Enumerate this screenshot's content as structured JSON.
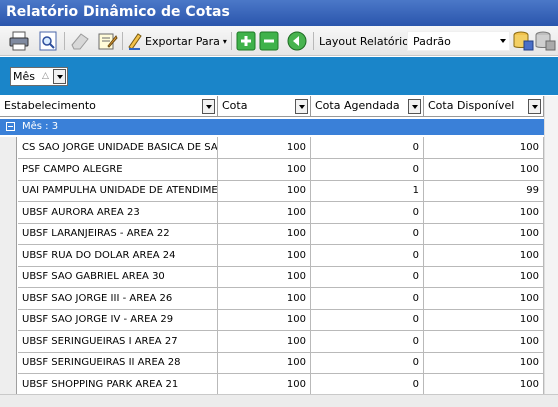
{
  "window": {
    "title": "Relatório Dinâmico de Cotas"
  },
  "toolbar": {
    "export_label": "Exportar Para",
    "layout_label": "Layout Relatório",
    "layout_value": "Padrão"
  },
  "group_panel": {
    "chip_label": "Mês"
  },
  "columns": [
    "Estabelecimento",
    "Cota",
    "Cota Agendada",
    "Cota Disponível"
  ],
  "group_row": {
    "label": "Mês : 3"
  },
  "rows": [
    {
      "estabelecimento": "CS SAO JORGE UNIDADE BASICA DE SAUD",
      "cota": "100",
      "agendada": "0",
      "disponivel": "100"
    },
    {
      "estabelecimento": "PSF CAMPO ALEGRE",
      "cota": "100",
      "agendada": "0",
      "disponivel": "100"
    },
    {
      "estabelecimento": "UAI PAMPULHA UNIDADE DE ATENDIMEN",
      "cota": "100",
      "agendada": "1",
      "disponivel": "99"
    },
    {
      "estabelecimento": "UBSF AURORA AREA 23",
      "cota": "100",
      "agendada": "0",
      "disponivel": "100"
    },
    {
      "estabelecimento": "UBSF LARANJEIRAS - AREA 22",
      "cota": "100",
      "agendada": "0",
      "disponivel": "100"
    },
    {
      "estabelecimento": "UBSF RUA DO DOLAR AREA 24",
      "cota": "100",
      "agendada": "0",
      "disponivel": "100"
    },
    {
      "estabelecimento": "UBSF SAO GABRIEL AREA 30",
      "cota": "100",
      "agendada": "0",
      "disponivel": "100"
    },
    {
      "estabelecimento": "UBSF SAO JORGE III - AREA 26",
      "cota": "100",
      "agendada": "0",
      "disponivel": "100"
    },
    {
      "estabelecimento": "UBSF SAO JORGE IV - AREA 29",
      "cota": "100",
      "agendada": "0",
      "disponivel": "100"
    },
    {
      "estabelecimento": "UBSF SERINGUEIRAS I AREA 27",
      "cota": "100",
      "agendada": "0",
      "disponivel": "100"
    },
    {
      "estabelecimento": "UBSF SERINGUEIRAS II AREA 28",
      "cota": "100",
      "agendada": "0",
      "disponivel": "100"
    },
    {
      "estabelecimento": "UBSF SHOPPING PARK AREA 21",
      "cota": "100",
      "agendada": "0",
      "disponivel": "100"
    }
  ],
  "colors": {
    "title_bar": "#2f5bb1",
    "group_panel": "#1a85c9",
    "group_row": "#3a80d8"
  }
}
